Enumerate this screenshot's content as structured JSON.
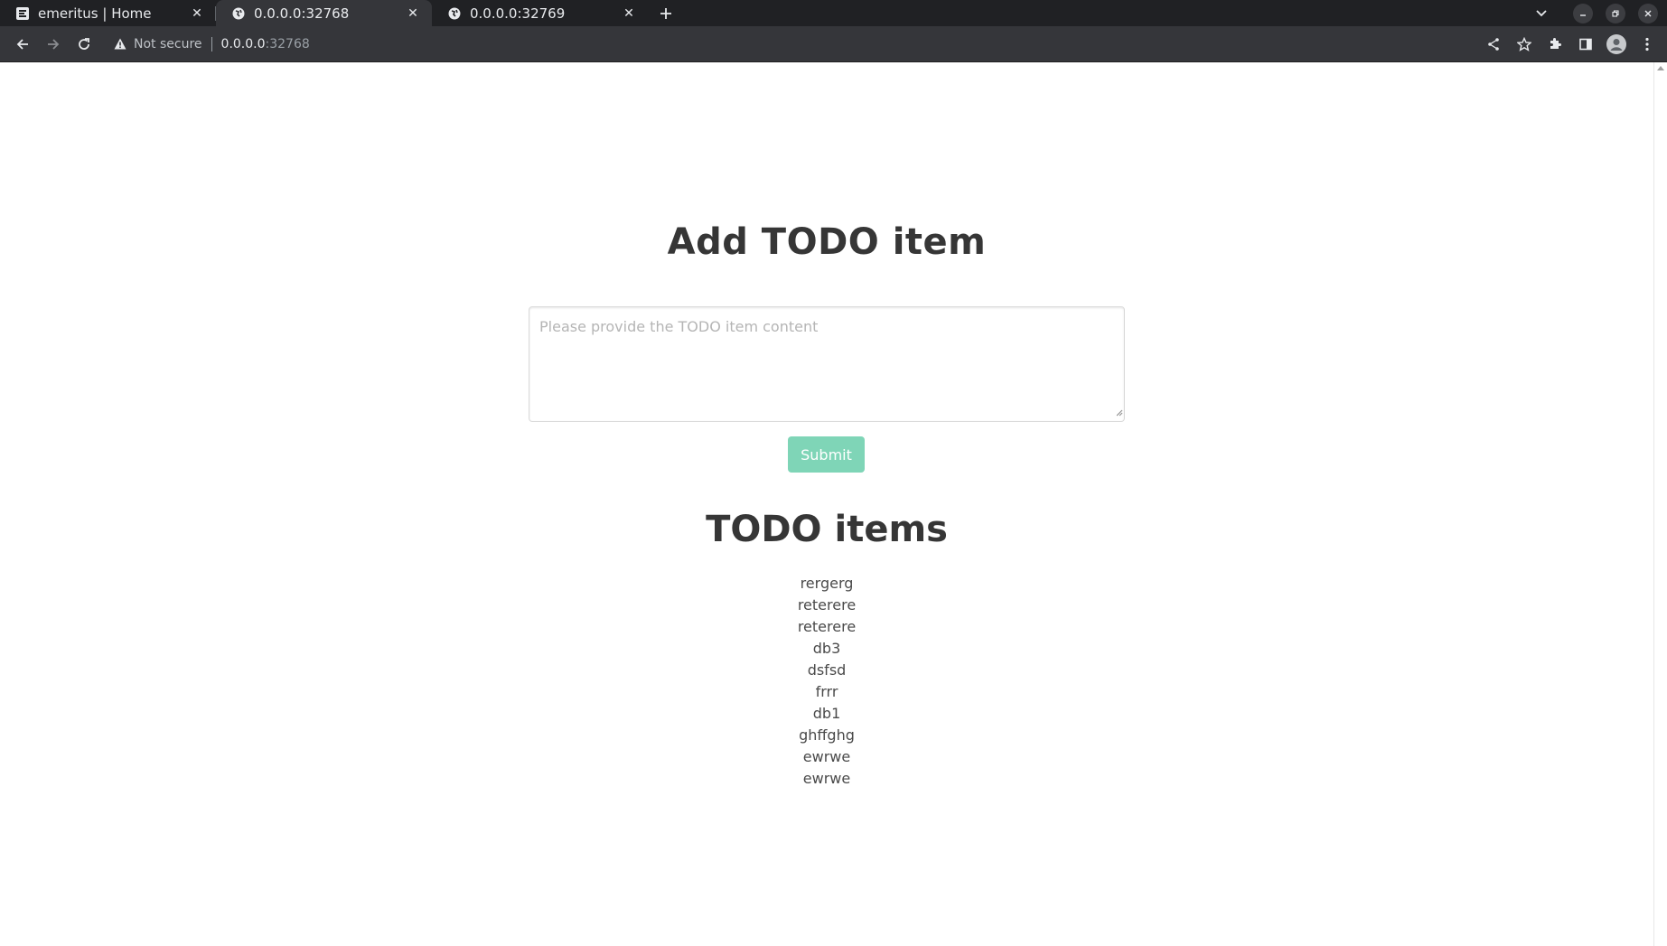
{
  "browser": {
    "tabs": [
      {
        "title": "emeritus | Home",
        "active": false,
        "favicon": "site-e-icon"
      },
      {
        "title": "0.0.0.0:32768",
        "active": true,
        "favicon": "globe-icon"
      },
      {
        "title": "0.0.0.0:32769",
        "active": false,
        "favicon": "globe-icon"
      }
    ],
    "omnibox": {
      "security_label": "Not secure",
      "host": "0.0.0.0",
      "port": ":32768"
    }
  },
  "page": {
    "add_title": "Add TODO item",
    "textarea_placeholder": "Please provide the TODO item content",
    "submit_label": "Submit",
    "list_title": "TODO items",
    "items": [
      "rergerg",
      "reterere",
      "reterere",
      "db3",
      "dsfsd",
      "frrr",
      "db1",
      "ghffghg",
      "ewrwe",
      "ewrwe"
    ],
    "colors": {
      "submit_bg": "#7fd5b7",
      "heading": "#363636",
      "text": "#4a4a4a"
    }
  }
}
